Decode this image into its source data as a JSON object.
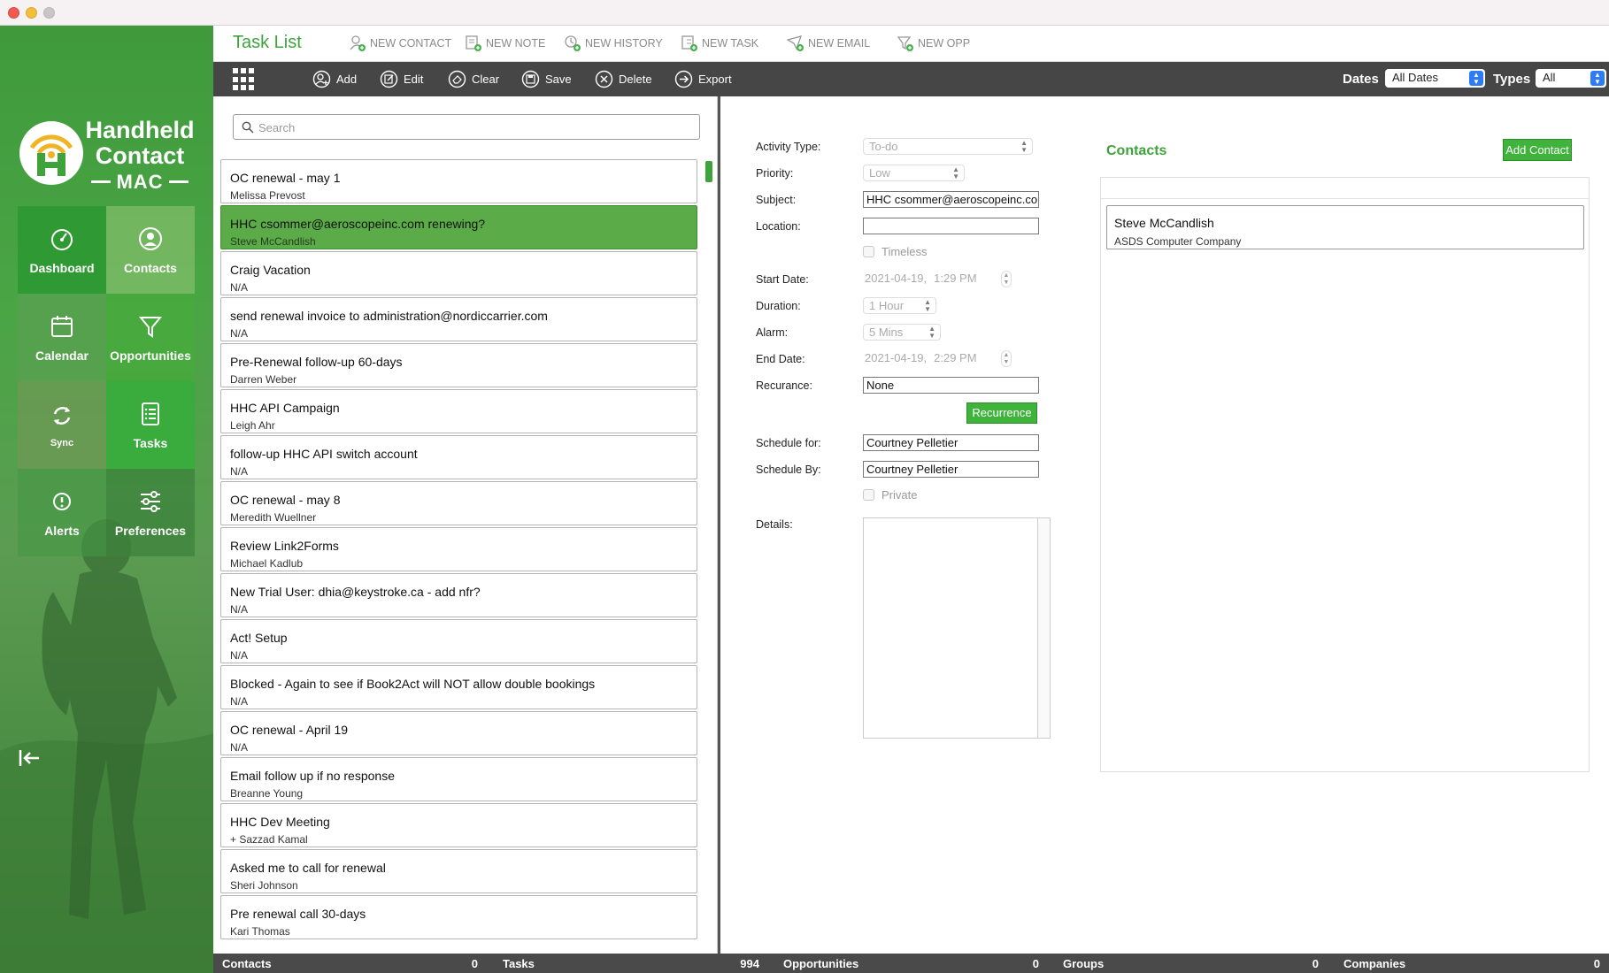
{
  "header": {
    "title": "Task List",
    "quick_actions": [
      "NEW CONTACT",
      "NEW NOTE",
      "NEW HISTORY",
      "NEW TASK",
      "NEW EMAIL",
      "NEW OPP"
    ]
  },
  "toolbar": {
    "buttons": [
      "Add",
      "Edit",
      "Clear",
      "Save",
      "Delete",
      "Export"
    ],
    "dates_label": "Dates",
    "dates_value": "All Dates",
    "types_label": "Types",
    "types_value": "All"
  },
  "brand": {
    "line1": "Handheld",
    "line2": "Contact",
    "line3": "MAC",
    "primary_color": "#3fa33c"
  },
  "nav": {
    "items": [
      "Dashboard",
      "Contacts",
      "Calendar",
      "Opportunities",
      "Sync",
      "Tasks",
      "Alerts",
      "Preferences"
    ]
  },
  "search": {
    "placeholder": "Search"
  },
  "tasks": [
    {
      "subject": "OC renewal - may 1",
      "who": "Melissa Prevost"
    },
    {
      "subject": "HHC csommer@aeroscopeinc.com renewing?",
      "who": "Steve McCandlish"
    },
    {
      "subject": "Craig Vacation",
      "who": "N/A"
    },
    {
      "subject": "send renewal invoice to administration@nordiccarrier.com",
      "who": "N/A"
    },
    {
      "subject": "Pre-Renewal follow-up 60-days",
      "who": "Darren Weber"
    },
    {
      "subject": "HHC API Campaign",
      "who": "Leigh Ahr"
    },
    {
      "subject": "follow-up HHC API switch account",
      "who": "N/A"
    },
    {
      "subject": "OC renewal - may 8",
      "who": "Meredith Wuellner"
    },
    {
      "subject": "Review Link2Forms",
      "who": "Michael Kadlub"
    },
    {
      "subject": "New Trial User: dhia@keystroke.ca - add nfr?",
      "who": "N/A"
    },
    {
      "subject": "Act! Setup",
      "who": "N/A"
    },
    {
      "subject": "Blocked - Again to see if Book2Act will NOT allow double bookings",
      "who": "N/A"
    },
    {
      "subject": "OC renewal - April 19",
      "who": "N/A"
    },
    {
      "subject": "Email follow up if no response",
      "who": "Breanne Young"
    },
    {
      "subject": "HHC Dev Meeting",
      "who": "+ Sazzad Kamal"
    },
    {
      "subject": "Asked me to call for renewal",
      "who": "Sheri Johnson"
    },
    {
      "subject": "Pre renewal call 30-days",
      "who": "Kari Thomas"
    }
  ],
  "form": {
    "activity_type_label": "Activity Type:",
    "activity_type": "To-do",
    "priority_label": "Priority:",
    "priority": "Low",
    "subject_label": "Subject:",
    "subject": "HHC csommer@aeroscopeinc.co",
    "location_label": "Location:",
    "location": "",
    "timeless_label": "Timeless",
    "start_date_label": "Start Date:",
    "start_date": "2021-04-19,",
    "start_time": "1:29 PM",
    "duration_label": "Duration:",
    "duration": "1 Hour",
    "alarm_label": "Alarm:",
    "alarm": "5 Mins",
    "end_date_label": "End Date:",
    "end_date": "2021-04-19,",
    "end_time": "2:29 PM",
    "recurance_label": "Recurance:",
    "recurance": "None",
    "recurrence_button": "Recurrence",
    "schedule_for_label": "Schedule for:",
    "schedule_for": "Courtney Pelletier",
    "schedule_by_label": "Schedule By:",
    "schedule_by": "Courtney Pelletier",
    "private_label": "Private",
    "details_label": "Details:"
  },
  "contacts": {
    "title": "Contacts",
    "add_button": "Add Contact",
    "items": [
      {
        "name": "Steve McCandlish",
        "company": "ASDS Computer Company"
      }
    ]
  },
  "status": [
    {
      "label": "Contacts",
      "count": "0"
    },
    {
      "label": "Tasks",
      "count": "994"
    },
    {
      "label": "Opportunities",
      "count": "0"
    },
    {
      "label": "Groups",
      "count": "0"
    },
    {
      "label": "Companies",
      "count": "0"
    }
  ]
}
